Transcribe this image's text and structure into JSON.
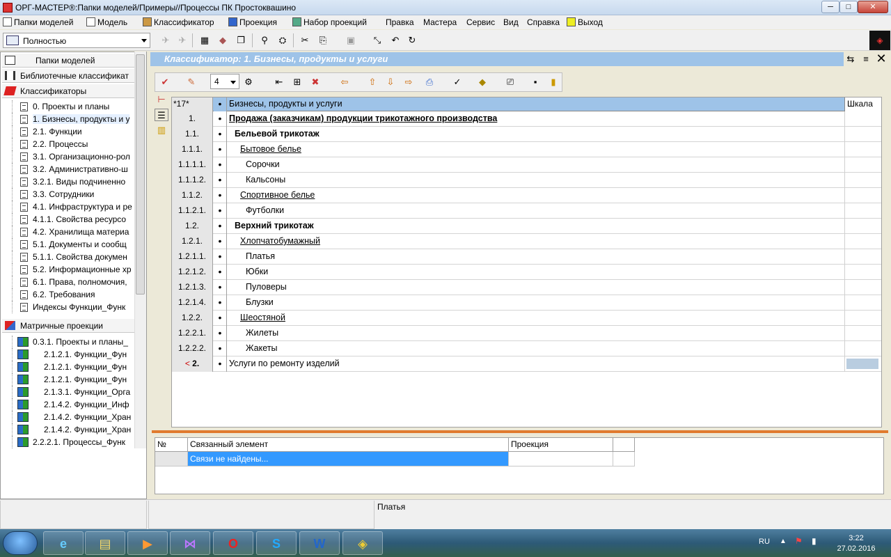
{
  "window": {
    "title": "ОРГ-МАСТЕР®:Папки моделей/Примеры//Процессы ПК Простоквашино",
    "minimize": "─",
    "maximize": "□",
    "close": "✕"
  },
  "menu": [
    "Папки моделей",
    "Модель",
    "Классификатор",
    "Проекция",
    "Набор проекций",
    "Правка",
    "Мастера",
    "Сервис",
    "Вид",
    "Справка",
    "Выход"
  ],
  "toolbar": {
    "zoom": "Полностью"
  },
  "left_panel": {
    "sections": {
      "folders": "Папки моделей",
      "library": "Библиотечные классификат",
      "classifiers": "Классификаторы",
      "matrix": "Матричные проекции"
    },
    "classifiers": [
      "0. Проекты и планы",
      "1. Бизнесы, продукты и у",
      "2.1. Функции",
      "2.2. Процессы",
      "3.1. Организационно-рол",
      "3.2. Административно-ш",
      "3.2.1. Виды подчиненно",
      "3.3. Сотрудники",
      "4.1. Инфраструктура и ре",
      "4.1.1. Свойства ресурсо",
      "4.2. Хранилища материа",
      "5.1. Документы и сообщ",
      "5.1.1. Свойства докумен",
      "5.2. Информационные хр",
      "6.1. Права, полномочия,",
      "6.2. Требования",
      "Индексы Функции_Функ"
    ],
    "matrix": [
      "0.3.1. Проекты и планы_",
      "2.1.2.1. Функции_Фун",
      "2.1.2.1. Функции_Фун",
      "2.1.2.1. Функции_Фун",
      "2.1.3.1. Функции_Орга",
      "2.1.4.2. Функции_Инф",
      "2.1.4.2. Функции_Хран",
      "2.1.4.2. Функции_Хран",
      "2.2.2.1. Процессы_Функ"
    ]
  },
  "classifier": {
    "title": "Классификатор: 1. Бизнесы, продукты и услуги",
    "level": "4",
    "header": {
      "count": "*17*",
      "name": "Бизнесы, продукты и услуги",
      "scale": "Шкала"
    },
    "rows": [
      {
        "num": "1.",
        "name": "Продажа (заказчикам) продукции трикотажного производства",
        "style": "bu",
        "indent": 0
      },
      {
        "num": "1.1.",
        "name": "Бельевой трикотаж",
        "style": "b",
        "indent": 1
      },
      {
        "num": "1.1.1.",
        "name": "Бытовое белье",
        "style": "u",
        "indent": 2
      },
      {
        "num": "1.1.1.1.",
        "name": "Сорочки",
        "style": "",
        "indent": 3
      },
      {
        "num": "1.1.1.2.",
        "name": "Кальсоны",
        "style": "",
        "indent": 3
      },
      {
        "num": "1.1.2.",
        "name": "Спортивное белье",
        "style": "u",
        "indent": 2
      },
      {
        "num": "1.1.2.1.",
        "name": "Футболки",
        "style": "",
        "indent": 3
      },
      {
        "num": "1.2.",
        "name": "Верхний трикотаж",
        "style": "b",
        "indent": 1
      },
      {
        "num": "1.2.1.",
        "name": "Хлопчатобумажный",
        "style": "u",
        "indent": 2
      },
      {
        "num": "1.2.1.1.",
        "name": "Платья",
        "style": "",
        "indent": 3
      },
      {
        "num": "1.2.1.2.",
        "name": "Юбки",
        "style": "",
        "indent": 3
      },
      {
        "num": "1.2.1.3.",
        "name": "Пуловеры",
        "style": "",
        "indent": 3
      },
      {
        "num": "1.2.1.4.",
        "name": "Блузки",
        "style": "",
        "indent": 3
      },
      {
        "num": "1.2.2.",
        "name": "Шеостяной",
        "style": "u",
        "indent": 2
      },
      {
        "num": "1.2.2.1.",
        "name": "Жилеты",
        "style": "",
        "indent": 3
      },
      {
        "num": "1.2.2.2.",
        "name": "Жакеты",
        "style": "",
        "indent": 3
      },
      {
        "num": "2.",
        "name": "Услуги по ремонту изделий",
        "style": "",
        "indent": 0,
        "prefix": "<",
        "numbold": true
      }
    ]
  },
  "links": {
    "col_num": "№",
    "col_element": "Связанный элемент",
    "col_projection": "Проекция",
    "empty": "Связи не найдены..."
  },
  "status": {
    "message": "Платья"
  },
  "taskbar": {
    "lang": "RU",
    "time": "3:22",
    "date": "27.02.2016"
  },
  "colors": {
    "header_bg": "#9ec3e8",
    "accent_orange": "#e07a2e",
    "selection_blue": "#3399ff"
  }
}
